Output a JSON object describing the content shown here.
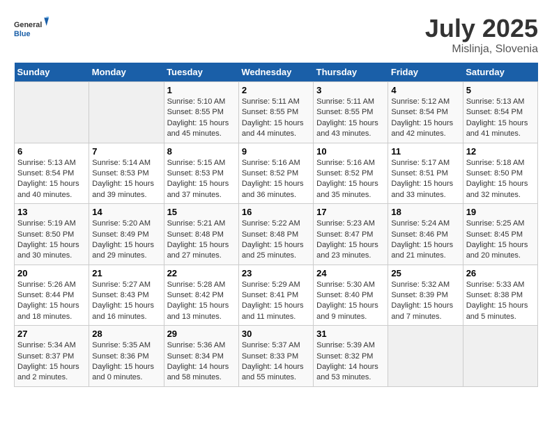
{
  "header": {
    "logo_general": "General",
    "logo_blue": "Blue",
    "title": "July 2025",
    "location": "Mislinja, Slovenia"
  },
  "days_of_week": [
    "Sunday",
    "Monday",
    "Tuesday",
    "Wednesday",
    "Thursday",
    "Friday",
    "Saturday"
  ],
  "weeks": [
    [
      {
        "day": "",
        "empty": true
      },
      {
        "day": "",
        "empty": true
      },
      {
        "day": "1",
        "sunrise": "5:10 AM",
        "sunset": "8:55 PM",
        "daylight": "15 hours and 45 minutes."
      },
      {
        "day": "2",
        "sunrise": "5:11 AM",
        "sunset": "8:55 PM",
        "daylight": "15 hours and 44 minutes."
      },
      {
        "day": "3",
        "sunrise": "5:11 AM",
        "sunset": "8:55 PM",
        "daylight": "15 hours and 43 minutes."
      },
      {
        "day": "4",
        "sunrise": "5:12 AM",
        "sunset": "8:54 PM",
        "daylight": "15 hours and 42 minutes."
      },
      {
        "day": "5",
        "sunrise": "5:13 AM",
        "sunset": "8:54 PM",
        "daylight": "15 hours and 41 minutes."
      }
    ],
    [
      {
        "day": "6",
        "sunrise": "5:13 AM",
        "sunset": "8:54 PM",
        "daylight": "15 hours and 40 minutes."
      },
      {
        "day": "7",
        "sunrise": "5:14 AM",
        "sunset": "8:53 PM",
        "daylight": "15 hours and 39 minutes."
      },
      {
        "day": "8",
        "sunrise": "5:15 AM",
        "sunset": "8:53 PM",
        "daylight": "15 hours and 37 minutes."
      },
      {
        "day": "9",
        "sunrise": "5:16 AM",
        "sunset": "8:52 PM",
        "daylight": "15 hours and 36 minutes."
      },
      {
        "day": "10",
        "sunrise": "5:16 AM",
        "sunset": "8:52 PM",
        "daylight": "15 hours and 35 minutes."
      },
      {
        "day": "11",
        "sunrise": "5:17 AM",
        "sunset": "8:51 PM",
        "daylight": "15 hours and 33 minutes."
      },
      {
        "day": "12",
        "sunrise": "5:18 AM",
        "sunset": "8:50 PM",
        "daylight": "15 hours and 32 minutes."
      }
    ],
    [
      {
        "day": "13",
        "sunrise": "5:19 AM",
        "sunset": "8:50 PM",
        "daylight": "15 hours and 30 minutes."
      },
      {
        "day": "14",
        "sunrise": "5:20 AM",
        "sunset": "8:49 PM",
        "daylight": "15 hours and 29 minutes."
      },
      {
        "day": "15",
        "sunrise": "5:21 AM",
        "sunset": "8:48 PM",
        "daylight": "15 hours and 27 minutes."
      },
      {
        "day": "16",
        "sunrise": "5:22 AM",
        "sunset": "8:48 PM",
        "daylight": "15 hours and 25 minutes."
      },
      {
        "day": "17",
        "sunrise": "5:23 AM",
        "sunset": "8:47 PM",
        "daylight": "15 hours and 23 minutes."
      },
      {
        "day": "18",
        "sunrise": "5:24 AM",
        "sunset": "8:46 PM",
        "daylight": "15 hours and 21 minutes."
      },
      {
        "day": "19",
        "sunrise": "5:25 AM",
        "sunset": "8:45 PM",
        "daylight": "15 hours and 20 minutes."
      }
    ],
    [
      {
        "day": "20",
        "sunrise": "5:26 AM",
        "sunset": "8:44 PM",
        "daylight": "15 hours and 18 minutes."
      },
      {
        "day": "21",
        "sunrise": "5:27 AM",
        "sunset": "8:43 PM",
        "daylight": "15 hours and 16 minutes."
      },
      {
        "day": "22",
        "sunrise": "5:28 AM",
        "sunset": "8:42 PM",
        "daylight": "15 hours and 13 minutes."
      },
      {
        "day": "23",
        "sunrise": "5:29 AM",
        "sunset": "8:41 PM",
        "daylight": "15 hours and 11 minutes."
      },
      {
        "day": "24",
        "sunrise": "5:30 AM",
        "sunset": "8:40 PM",
        "daylight": "15 hours and 9 minutes."
      },
      {
        "day": "25",
        "sunrise": "5:32 AM",
        "sunset": "8:39 PM",
        "daylight": "15 hours and 7 minutes."
      },
      {
        "day": "26",
        "sunrise": "5:33 AM",
        "sunset": "8:38 PM",
        "daylight": "15 hours and 5 minutes."
      }
    ],
    [
      {
        "day": "27",
        "sunrise": "5:34 AM",
        "sunset": "8:37 PM",
        "daylight": "15 hours and 2 minutes."
      },
      {
        "day": "28",
        "sunrise": "5:35 AM",
        "sunset": "8:36 PM",
        "daylight": "15 hours and 0 minutes."
      },
      {
        "day": "29",
        "sunrise": "5:36 AM",
        "sunset": "8:34 PM",
        "daylight": "14 hours and 58 minutes."
      },
      {
        "day": "30",
        "sunrise": "5:37 AM",
        "sunset": "8:33 PM",
        "daylight": "14 hours and 55 minutes."
      },
      {
        "day": "31",
        "sunrise": "5:39 AM",
        "sunset": "8:32 PM",
        "daylight": "14 hours and 53 minutes."
      },
      {
        "day": "",
        "empty": true
      },
      {
        "day": "",
        "empty": true
      }
    ]
  ]
}
